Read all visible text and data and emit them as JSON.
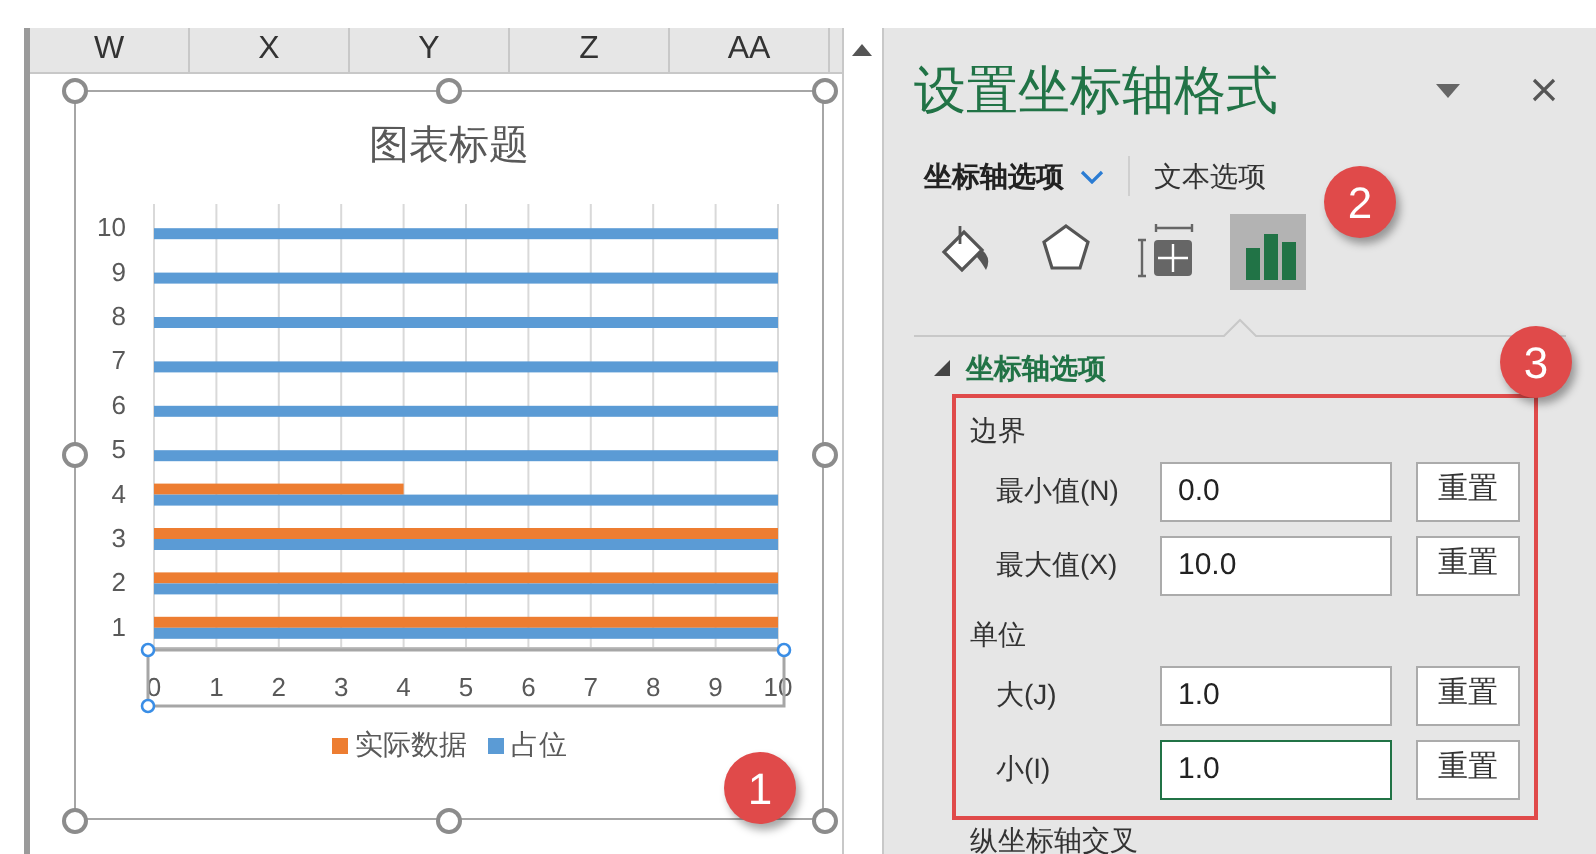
{
  "spreadsheet": {
    "columns": [
      "W",
      "X",
      "Y",
      "Z",
      "AA"
    ]
  },
  "chart": {
    "title": "图表标题",
    "badge": "1",
    "chart_data": {
      "type": "bar",
      "orientation": "horizontal",
      "categories": [
        "10",
        "9",
        "8",
        "7",
        "6",
        "5",
        "4",
        "3",
        "2",
        "1"
      ],
      "series": [
        {
          "name": "实际数据",
          "color": "#ed7d31",
          "values": [
            0,
            0,
            0,
            0,
            0,
            0,
            4,
            10,
            10,
            10
          ]
        },
        {
          "name": "占位",
          "color": "#5b9bd5",
          "values": [
            10,
            10,
            10,
            10,
            10,
            10,
            10,
            10,
            10,
            10
          ]
        }
      ],
      "xlim": [
        0,
        10
      ],
      "xticks": [
        0,
        1,
        2,
        3,
        4,
        5,
        6,
        7,
        8,
        9,
        10
      ],
      "grid": true
    }
  },
  "pane": {
    "title": "设置坐标轴格式",
    "tabs": [
      {
        "label": "坐标轴选项",
        "selected": true
      },
      {
        "label": "文本选项",
        "selected": false
      }
    ],
    "icon_tabs": [
      {
        "kind": "fill",
        "selected": false
      },
      {
        "kind": "effects",
        "selected": false
      },
      {
        "kind": "size",
        "selected": false
      },
      {
        "kind": "axis",
        "selected": true
      }
    ],
    "icon_badge": "2",
    "section": {
      "title": "坐标轴选项",
      "expanded": true
    },
    "highlight_badge": "3",
    "groups": [
      {
        "title": "边界",
        "fields": [
          {
            "label": "最小值(N)",
            "value": "0.0",
            "focused": false,
            "button": "重置"
          },
          {
            "label": "最大值(X)",
            "value": "10.0",
            "focused": false,
            "button": "重置"
          }
        ]
      },
      {
        "title": "单位",
        "fields": [
          {
            "label": "大(J)",
            "value": "1.0",
            "focused": false,
            "button": "重置"
          },
          {
            "label": "小(I)",
            "value": "1.0",
            "focused": true,
            "button": "重置"
          }
        ]
      }
    ],
    "next_section": "纵坐标轴交叉"
  }
}
